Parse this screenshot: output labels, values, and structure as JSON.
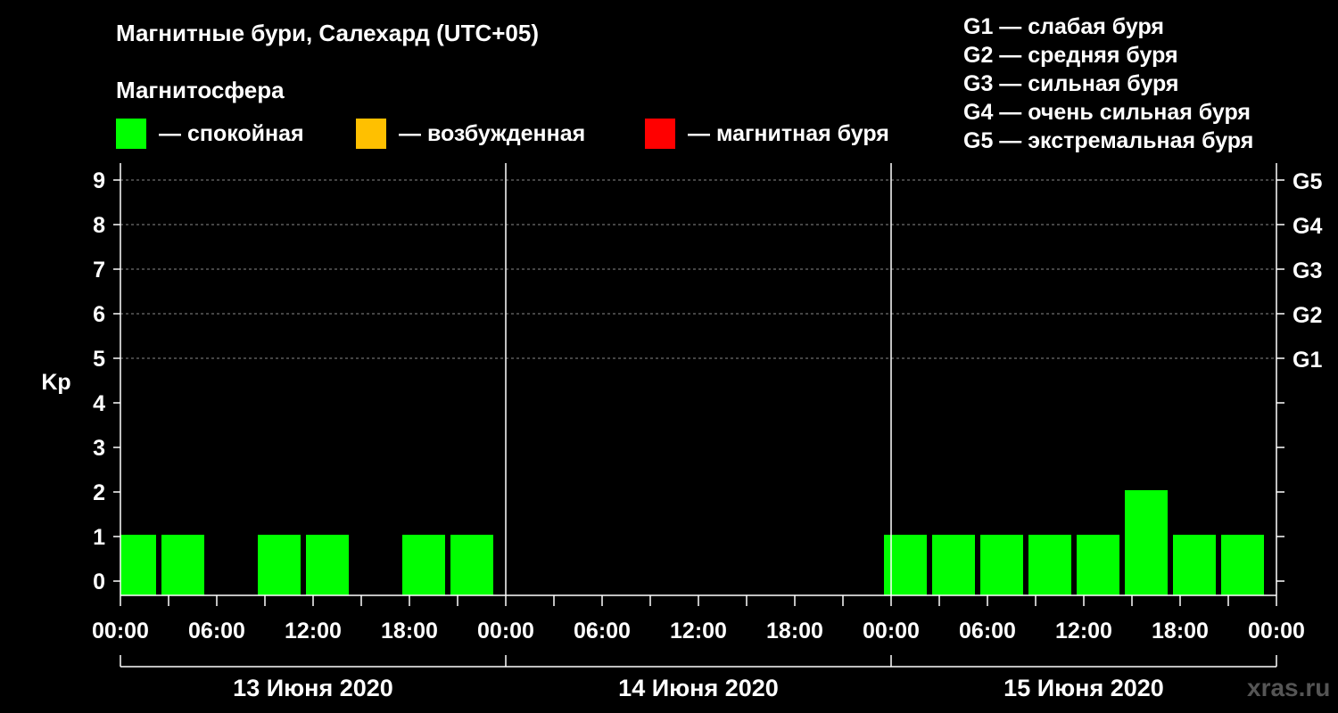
{
  "header": {
    "title": "Магнитные бури, Салехард (UTC+05)",
    "subtitle": "Магнитосфера"
  },
  "legend": {
    "items": [
      {
        "label": "— спокойная",
        "color": "#00ff00"
      },
      {
        "label": "— возбужденная",
        "color": "#ffc000"
      },
      {
        "label": "— магнитная буря",
        "color": "#ff0000"
      }
    ],
    "g_scale": [
      "G1 — слабая буря",
      "G2 — средняя буря",
      "G3 — сильная буря",
      "G4 — очень сильная буря",
      "G5 — экстремальная буря"
    ]
  },
  "watermark": "xras.ru",
  "chart_data": {
    "type": "bar",
    "ylabel": "Kp",
    "ylim": [
      0,
      9
    ],
    "y_ticks": [
      "0",
      "1",
      "2",
      "3",
      "4",
      "5",
      "6",
      "7",
      "8",
      "9"
    ],
    "y_right_ticks": [
      {
        "kp": 5,
        "label": "G1"
      },
      {
        "kp": 6,
        "label": "G2"
      },
      {
        "kp": 7,
        "label": "G3"
      },
      {
        "kp": 8,
        "label": "G4"
      },
      {
        "kp": 9,
        "label": "G5"
      }
    ],
    "x_tick_labels": [
      "00:00",
      "06:00",
      "12:00",
      "18:00",
      "00:00",
      "06:00",
      "12:00",
      "18:00",
      "00:00",
      "06:00",
      "12:00",
      "18:00",
      "00:00"
    ],
    "days": [
      "13 Июня 2020",
      "14 Июня 2020",
      "15 Июня 2020"
    ],
    "grid": "dashed horizontal at 5–9, solid vertical at day boundaries",
    "bar_color": "#00ff00",
    "series": [
      {
        "values": [
          [
            1,
            1,
            null,
            1,
            1,
            null,
            1,
            1
          ],
          [
            null,
            null,
            null,
            null,
            null,
            null,
            null,
            null
          ],
          [
            1,
            1,
            1,
            1,
            1,
            2,
            1,
            1
          ]
        ]
      }
    ]
  }
}
